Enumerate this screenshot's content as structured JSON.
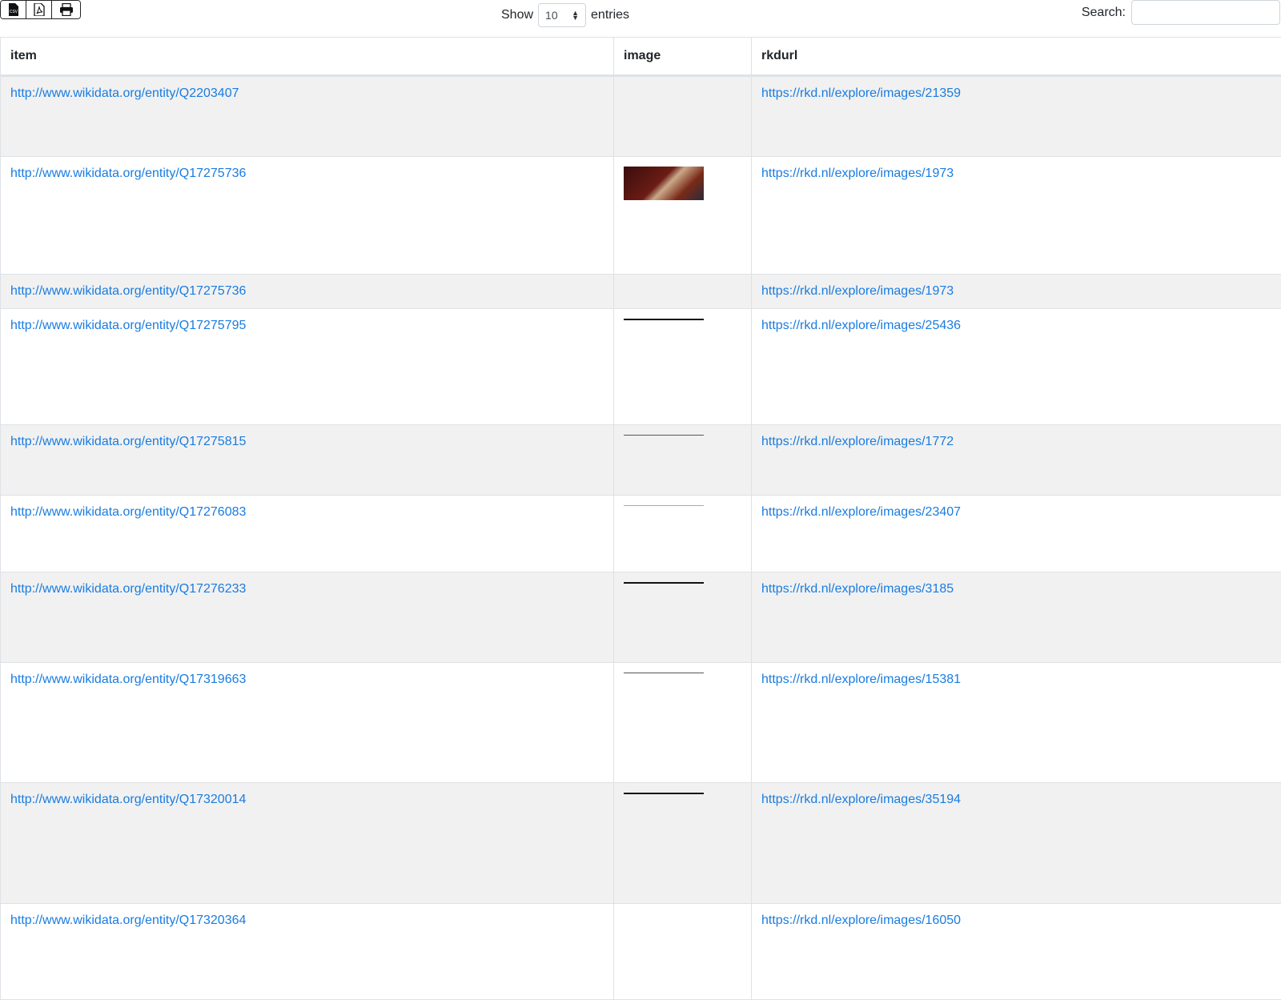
{
  "controls": {
    "show_label": "Show",
    "page_length": "10",
    "entries_label": "entries",
    "search_label": "Search:",
    "search_value": ""
  },
  "table": {
    "columns": [
      "item",
      "image",
      "rkdurl"
    ],
    "rows": [
      {
        "item": "http://www.wikidata.org/entity/Q2203407",
        "image": "none",
        "rkdurl": "https://rkd.nl/explore/images/21359"
      },
      {
        "item": "http://www.wikidata.org/entity/Q17275736",
        "image": "painting",
        "rkdurl": "https://rkd.nl/explore/images/1973"
      },
      {
        "item": "http://www.wikidata.org/entity/Q17275736",
        "image": "none",
        "rkdurl": "https://rkd.nl/explore/images/1973"
      },
      {
        "item": "http://www.wikidata.org/entity/Q17275795",
        "image": "line",
        "rkdurl": "https://rkd.nl/explore/images/25436"
      },
      {
        "item": "http://www.wikidata.org/entity/Q17275815",
        "image": "thin",
        "rkdurl": "https://rkd.nl/explore/images/1772"
      },
      {
        "item": "http://www.wikidata.org/entity/Q17276083",
        "image": "faint",
        "rkdurl": "https://rkd.nl/explore/images/23407"
      },
      {
        "item": "http://www.wikidata.org/entity/Q17276233",
        "image": "line",
        "rkdurl": "https://rkd.nl/explore/images/3185"
      },
      {
        "item": "http://www.wikidata.org/entity/Q17319663",
        "image": "thin",
        "rkdurl": "https://rkd.nl/explore/images/15381"
      },
      {
        "item": "http://www.wikidata.org/entity/Q17320014",
        "image": "line",
        "rkdurl": "https://rkd.nl/explore/images/35194"
      },
      {
        "item": "http://www.wikidata.org/entity/Q17320364",
        "image": "none",
        "rkdurl": "https://rkd.nl/explore/images/16050"
      }
    ]
  }
}
